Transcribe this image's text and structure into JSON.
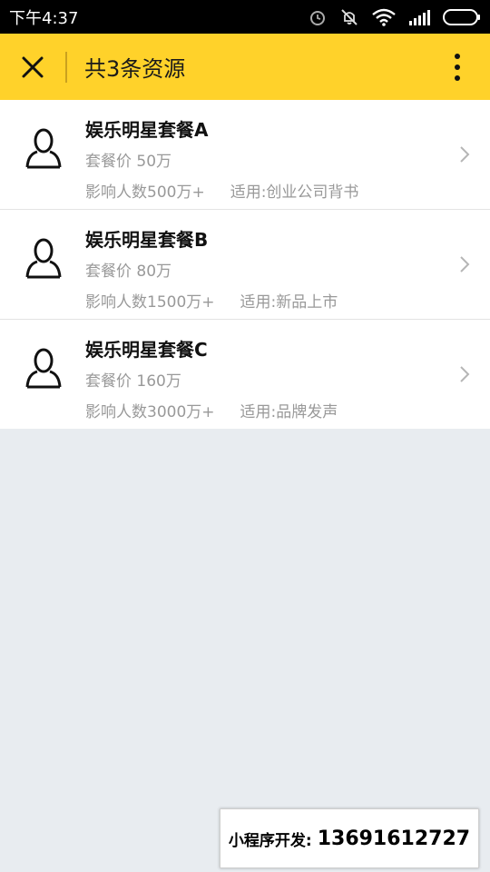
{
  "status_bar": {
    "time": "下午4:37",
    "icons": [
      "alarm-icon",
      "mute-icon",
      "wifi-icon",
      "signal-icon",
      "battery-icon"
    ]
  },
  "navbar": {
    "title": "共3条资源",
    "background": "#ffd22a",
    "close_icon": "close-icon",
    "more_icon": "more-vertical-icon"
  },
  "items": [
    {
      "name": "娱乐明星套餐A",
      "price": "套餐价 50万",
      "reach": "影响人数500万+",
      "fit": "适用:创业公司背书"
    },
    {
      "name": "娱乐明星套餐B",
      "price": "套餐价 80万",
      "reach": "影响人数1500万+",
      "fit": "适用:新品上市"
    },
    {
      "name": "娱乐明星套餐C",
      "price": "套餐价 160万",
      "reach": "影响人数3000万+",
      "fit": "适用:品牌发声"
    }
  ],
  "contact": {
    "label": "小程序开发:",
    "phone": "13691612727"
  }
}
